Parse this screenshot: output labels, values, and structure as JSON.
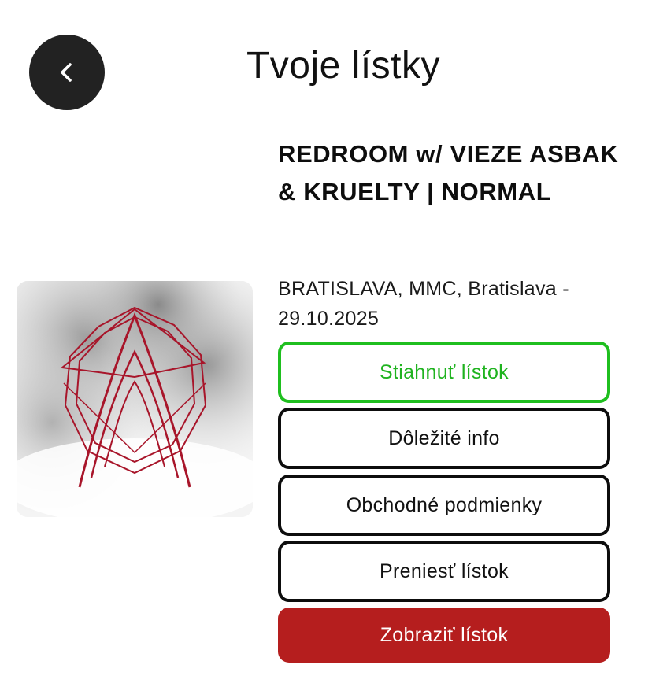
{
  "header": {
    "title": "Tvoje lístky",
    "back_icon": "chevron-left-icon"
  },
  "event": {
    "name": "REDROOM w/ VIEZE ASBAK & KRUELTY | NORMAL",
    "location": "BRATISLAVA, MMC, Bratislava -",
    "date": "29.10.2025",
    "art_logo_color": "#a8152a"
  },
  "actions": {
    "download_label": "Stiahnuť lístok",
    "info_label": "Dôležité info",
    "terms_label": "Obchodné podmienky",
    "transfer_label": "Preniesť lístok",
    "show_label": "Zobraziť lístok"
  },
  "colors": {
    "back_button": "#222222",
    "download_border": "#1fbf1f",
    "show_button": "#b51e1e"
  }
}
